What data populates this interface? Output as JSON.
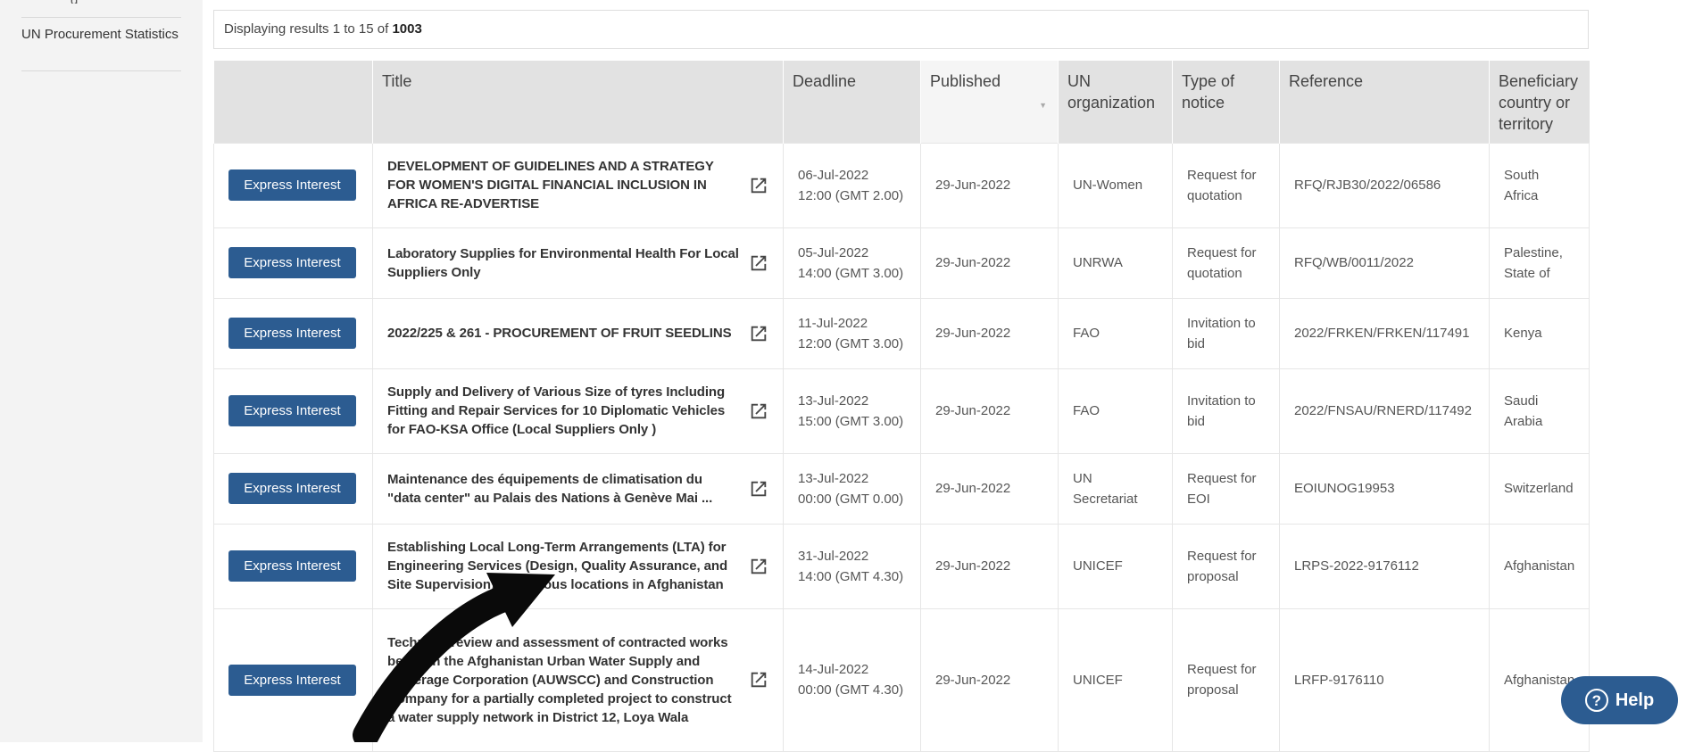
{
  "sidebar": {
    "prev_item_fragment": "g",
    "nav_item": "UN Procurement Statistics"
  },
  "results": {
    "prefix": "Displaying results 1 to 15 of ",
    "total": "1003"
  },
  "table": {
    "headers": {
      "title": "Title",
      "deadline": "Deadline",
      "published": "Published",
      "organization": "UN organization",
      "type": "Type of notice",
      "reference": "Reference",
      "country": "Beneficiary country or territory"
    },
    "button_label": "Express Interest",
    "rows": [
      {
        "title": "DEVELOPMENT OF GUIDELINES AND A STRATEGY FOR WOMEN'S DIGITAL FINANCIAL INCLUSION IN AFRICA RE-ADVERTISE",
        "deadline_date": "06-Jul-2022",
        "deadline_time": "12:00 (GMT 2.00)",
        "published": "29-Jun-2022",
        "organization": "UN-Women",
        "type": "Request for quotation",
        "reference": "RFQ/RJB30/2022/06586",
        "country": "South Africa"
      },
      {
        "title": "Laboratory Supplies for Environmental Health For Local Suppliers Only",
        "deadline_date": "05-Jul-2022",
        "deadline_time": "14:00 (GMT 3.00)",
        "published": "29-Jun-2022",
        "organization": "UNRWA",
        "type": "Request for quotation",
        "reference": "RFQ/WB/0011/2022",
        "country": "Palestine, State of"
      },
      {
        "title": "2022/225 & 261 - PROCUREMENT OF FRUIT SEEDLINS",
        "deadline_date": "11-Jul-2022",
        "deadline_time": "12:00 (GMT 3.00)",
        "published": "29-Jun-2022",
        "organization": "FAO",
        "type": "Invitation to bid",
        "reference": "2022/FRKEN/FRKEN/117491",
        "country": "Kenya"
      },
      {
        "title": "Supply and Delivery of Various Size of tyres Including Fitting and Repair Services for 10 Diplomatic Vehicles for FAO-KSA Office (Local Suppliers Only )",
        "deadline_date": "13-Jul-2022",
        "deadline_time": "15:00 (GMT 3.00)",
        "published": "29-Jun-2022",
        "organization": "FAO",
        "type": "Invitation to bid",
        "reference": "2022/FNSAU/RNERD/117492",
        "country": "Saudi Arabia"
      },
      {
        "title_line1": "Maintenance des équipements de climatisation du",
        "title_line2": "\"data center\" au Palais des Nations à Genève Mai ...",
        "deadline_date": "13-Jul-2022",
        "deadline_time": "00:00 (GMT 0.00)",
        "published": "29-Jun-2022",
        "organization": "UN Secretariat",
        "type": "Request for EOI",
        "reference": "EOIUNOG19953",
        "country": "Switzerland"
      },
      {
        "title": "Establishing Local Long-Term Arrangements (LTA) for Engineering Services (Design, Quality Assurance, and Site Supervision) for various locations in Afghanistan",
        "deadline_date": "31-Jul-2022",
        "deadline_time": "14:00 (GMT 4.30)",
        "published": "29-Jun-2022",
        "organization": "UNICEF",
        "type": "Request for proposal",
        "reference": "LRPS-2022-9176112",
        "country": "Afghanistan"
      },
      {
        "title": "Technical review and assessment of contracted works between the Afghanistan Urban Water Supply and Sewerage Corporation (AUWSCC) and Construction Company for a partially completed project to construct a water supply network in District 12, Loya Wala",
        "deadline_date": "14-Jul-2022",
        "deadline_time": "00:00 (GMT 4.30)",
        "published": "29-Jun-2022",
        "organization": "UNICEF",
        "type": "Request for proposal",
        "reference": "LRFP-9176110",
        "country": "Afghanistan"
      }
    ]
  },
  "help": {
    "label": "Help",
    "icon_glyph": "?"
  },
  "icons": {
    "external_link": "external-link-icon",
    "help": "question-circle-icon",
    "annotation": "curved-arrow-icon"
  },
  "colors": {
    "button": "#2c5c91",
    "header_bg": "#e2e2e2",
    "sidebar_bg": "#f3f3f3"
  }
}
